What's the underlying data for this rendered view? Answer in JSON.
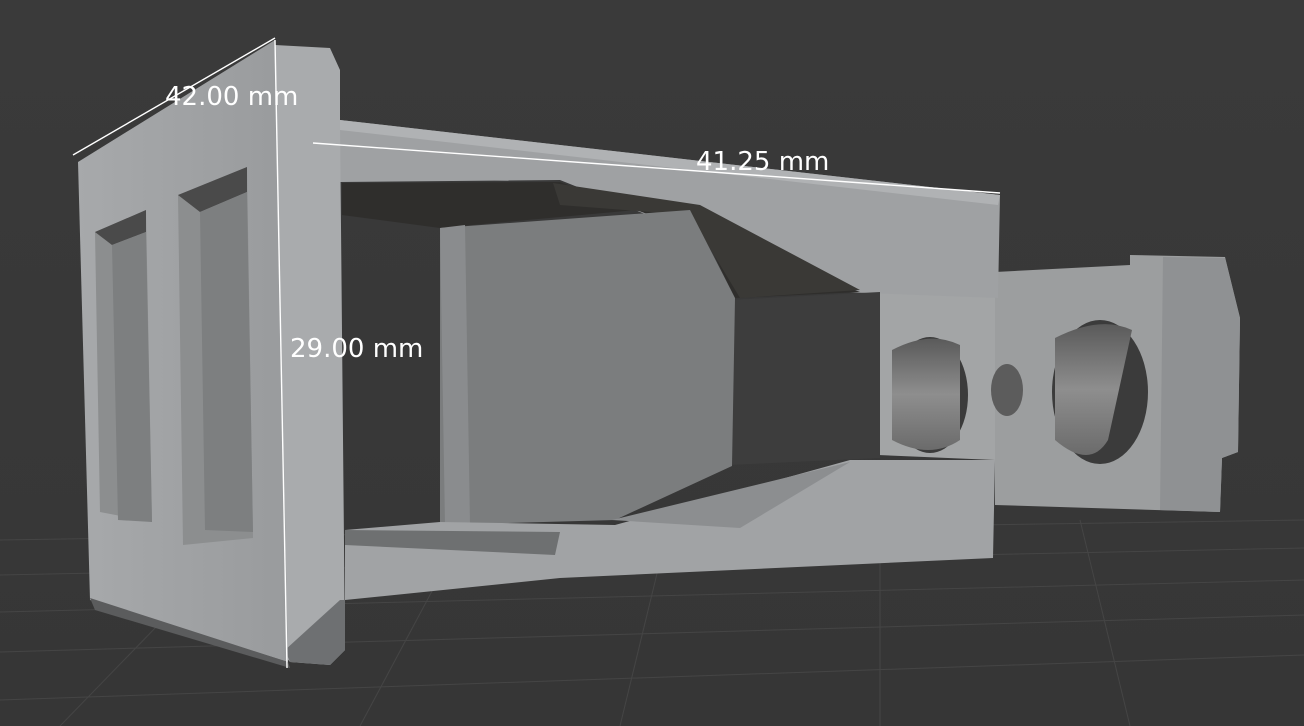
{
  "viewport": {
    "background": "#3a3a3a",
    "grid_color": "#4a4a4a"
  },
  "model": {
    "face_color": "#9b9d9f",
    "side_color": "#8a8c8e",
    "shadow_color": "#2f2e2c",
    "highlight_color": "#b5b7b8"
  },
  "measurements": [
    {
      "id": "width",
      "label": "42.00 mm"
    },
    {
      "id": "length",
      "label": "41.25 mm"
    },
    {
      "id": "height",
      "label": "29.00 mm"
    }
  ]
}
